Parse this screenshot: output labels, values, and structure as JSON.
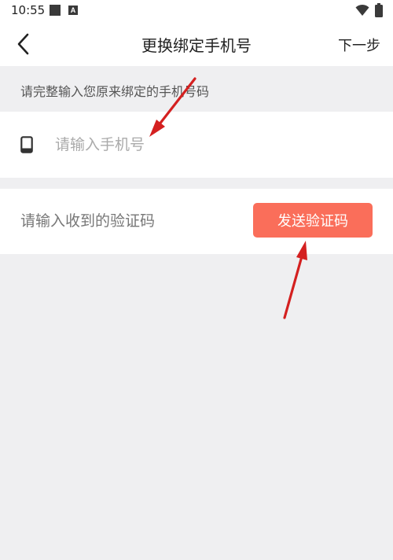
{
  "status_bar": {
    "time": "10:55",
    "notification_badge": "A",
    "icons": [
      "square-notification-icon",
      "a-notification-icon",
      "wifi-icon",
      "battery-icon"
    ]
  },
  "header": {
    "back_icon": "chevron-left-icon",
    "title": "更换绑定手机号",
    "next_label": "下一步"
  },
  "hint": {
    "text": "请完整输入您原来绑定的手机号码"
  },
  "phone_field": {
    "icon": "phone-icon",
    "value": "",
    "placeholder": "请输入手机号"
  },
  "code_field": {
    "value": "",
    "placeholder": "请输入收到的验证码",
    "send_button_label": "发送验证码"
  },
  "colors": {
    "accent": "#fa6e5a",
    "background": "#efeff1",
    "surface": "#ffffff",
    "annotation_arrow": "#d42020"
  }
}
